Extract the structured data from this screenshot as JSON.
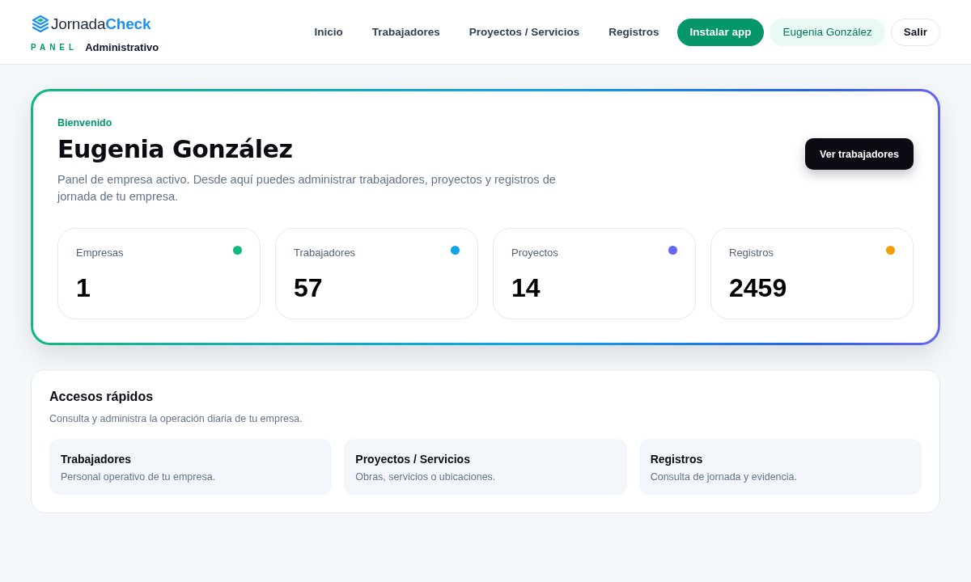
{
  "header": {
    "brand": {
      "name_parts": [
        "Jornada",
        "Check"
      ],
      "tag": "PANEL",
      "subtitle": "Administrativo"
    },
    "nav": [
      "Inicio",
      "Trabajadores",
      "Proyectos / Servicios",
      "Registros"
    ],
    "actions": [
      {
        "label": "Instalar app",
        "kind": "primary"
      },
      {
        "label": "Eugenia González",
        "kind": "user"
      },
      {
        "label": "Salir",
        "kind": "outline"
      }
    ]
  },
  "welcome": {
    "eyebrow": "Bienvenido",
    "title": "Eugenia González",
    "description": "Panel de empresa activo. Desde aquí puedes administrar trabajadores, proyectos y registros de jornada de tu empresa.",
    "button": "Ver trabajadores",
    "stats": [
      {
        "label": "Empresas",
        "value": "1",
        "color": "#10b981"
      },
      {
        "label": "Trabajadores",
        "value": "57",
        "color": "#0ea5e9"
      },
      {
        "label": "Proyectos",
        "value": "14",
        "color": "#6366f1"
      },
      {
        "label": "Registros",
        "value": "2459",
        "color": "#f59e0b"
      }
    ]
  },
  "quick_access": {
    "title": "Accesos rápidos",
    "subtitle": "Consulta y administra la operación diaria de tu empresa.",
    "items": [
      {
        "title": "Trabajadores",
        "description": "Personal operativo de tu empresa."
      },
      {
        "title": "Proyectos / Servicios",
        "description": "Obras, servicios o ubicaciones."
      },
      {
        "title": "Registros",
        "description": "Consulta de jornada y evidencia."
      }
    ]
  }
}
